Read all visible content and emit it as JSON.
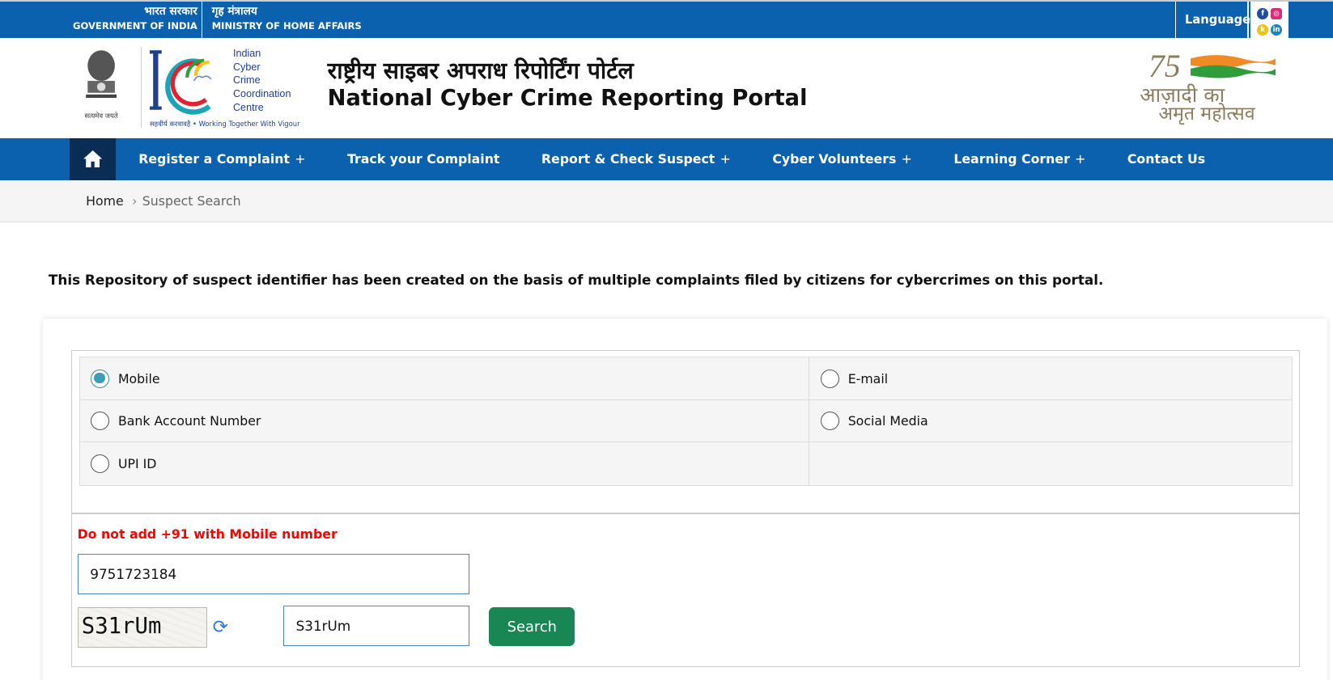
{
  "topbar": {
    "gov_hi": "भारत सरकार",
    "gov_en": "GOVERNMENT OF INDIA",
    "ministry_hi": "गृह मंत्रालय",
    "ministry_en": "MINISTRY OF HOME AFFAIRS",
    "language_label": "Language",
    "social": [
      "facebook",
      "instagram",
      "koo",
      "linkedin"
    ]
  },
  "header": {
    "emblem_motto": "सत्यमेव जयते",
    "i4c_letters": [
      "Indian",
      "Cyber",
      "Crime",
      "Coordination",
      "Centre"
    ],
    "i4c_tagline": "सहवीर्य करवावहै  •  Working Together With Vigour",
    "title_hi": "राष्ट्रीय साइबर अपराध रिपोर्टिंग पोर्टल",
    "title_en": "National Cyber Crime Reporting Portal",
    "azadi_number": "75",
    "azadi_line1": "आज़ादी का",
    "azadi_line2": "अमृत महोत्सव"
  },
  "nav": {
    "items": [
      {
        "label": "Register a Complaint",
        "plus": "+"
      },
      {
        "label": "Track your Complaint",
        "plus": ""
      },
      {
        "label": "Report & Check Suspect",
        "plus": "+"
      },
      {
        "label": "Cyber Volunteers",
        "plus": "+"
      },
      {
        "label": "Learning Corner",
        "plus": "+"
      },
      {
        "label": "Contact Us",
        "plus": ""
      }
    ]
  },
  "breadcrumb": {
    "home": "Home",
    "current": "Suspect Search"
  },
  "intro": "This Repository of suspect identifier has been created on the basis of multiple complaints filed by citizens for cybercrimes on this portal.",
  "search_types": [
    {
      "label": "Mobile",
      "selected": true
    },
    {
      "label": "E-mail",
      "selected": false
    },
    {
      "label": "Bank Account Number",
      "selected": false
    },
    {
      "label": "Social Media",
      "selected": false
    },
    {
      "label": "UPI ID",
      "selected": false
    }
  ],
  "form": {
    "warning": "Do not add +91 with Mobile number",
    "mobile_value": "9751723184",
    "captcha_image_text": "S31rUm",
    "captcha_value": "S31rUm",
    "search_label": "Search"
  },
  "colors": {
    "brand_blue": "#0b61ae",
    "home_dark": "#0a2d55",
    "search_green": "#198754",
    "warning_red": "#ff0000"
  }
}
